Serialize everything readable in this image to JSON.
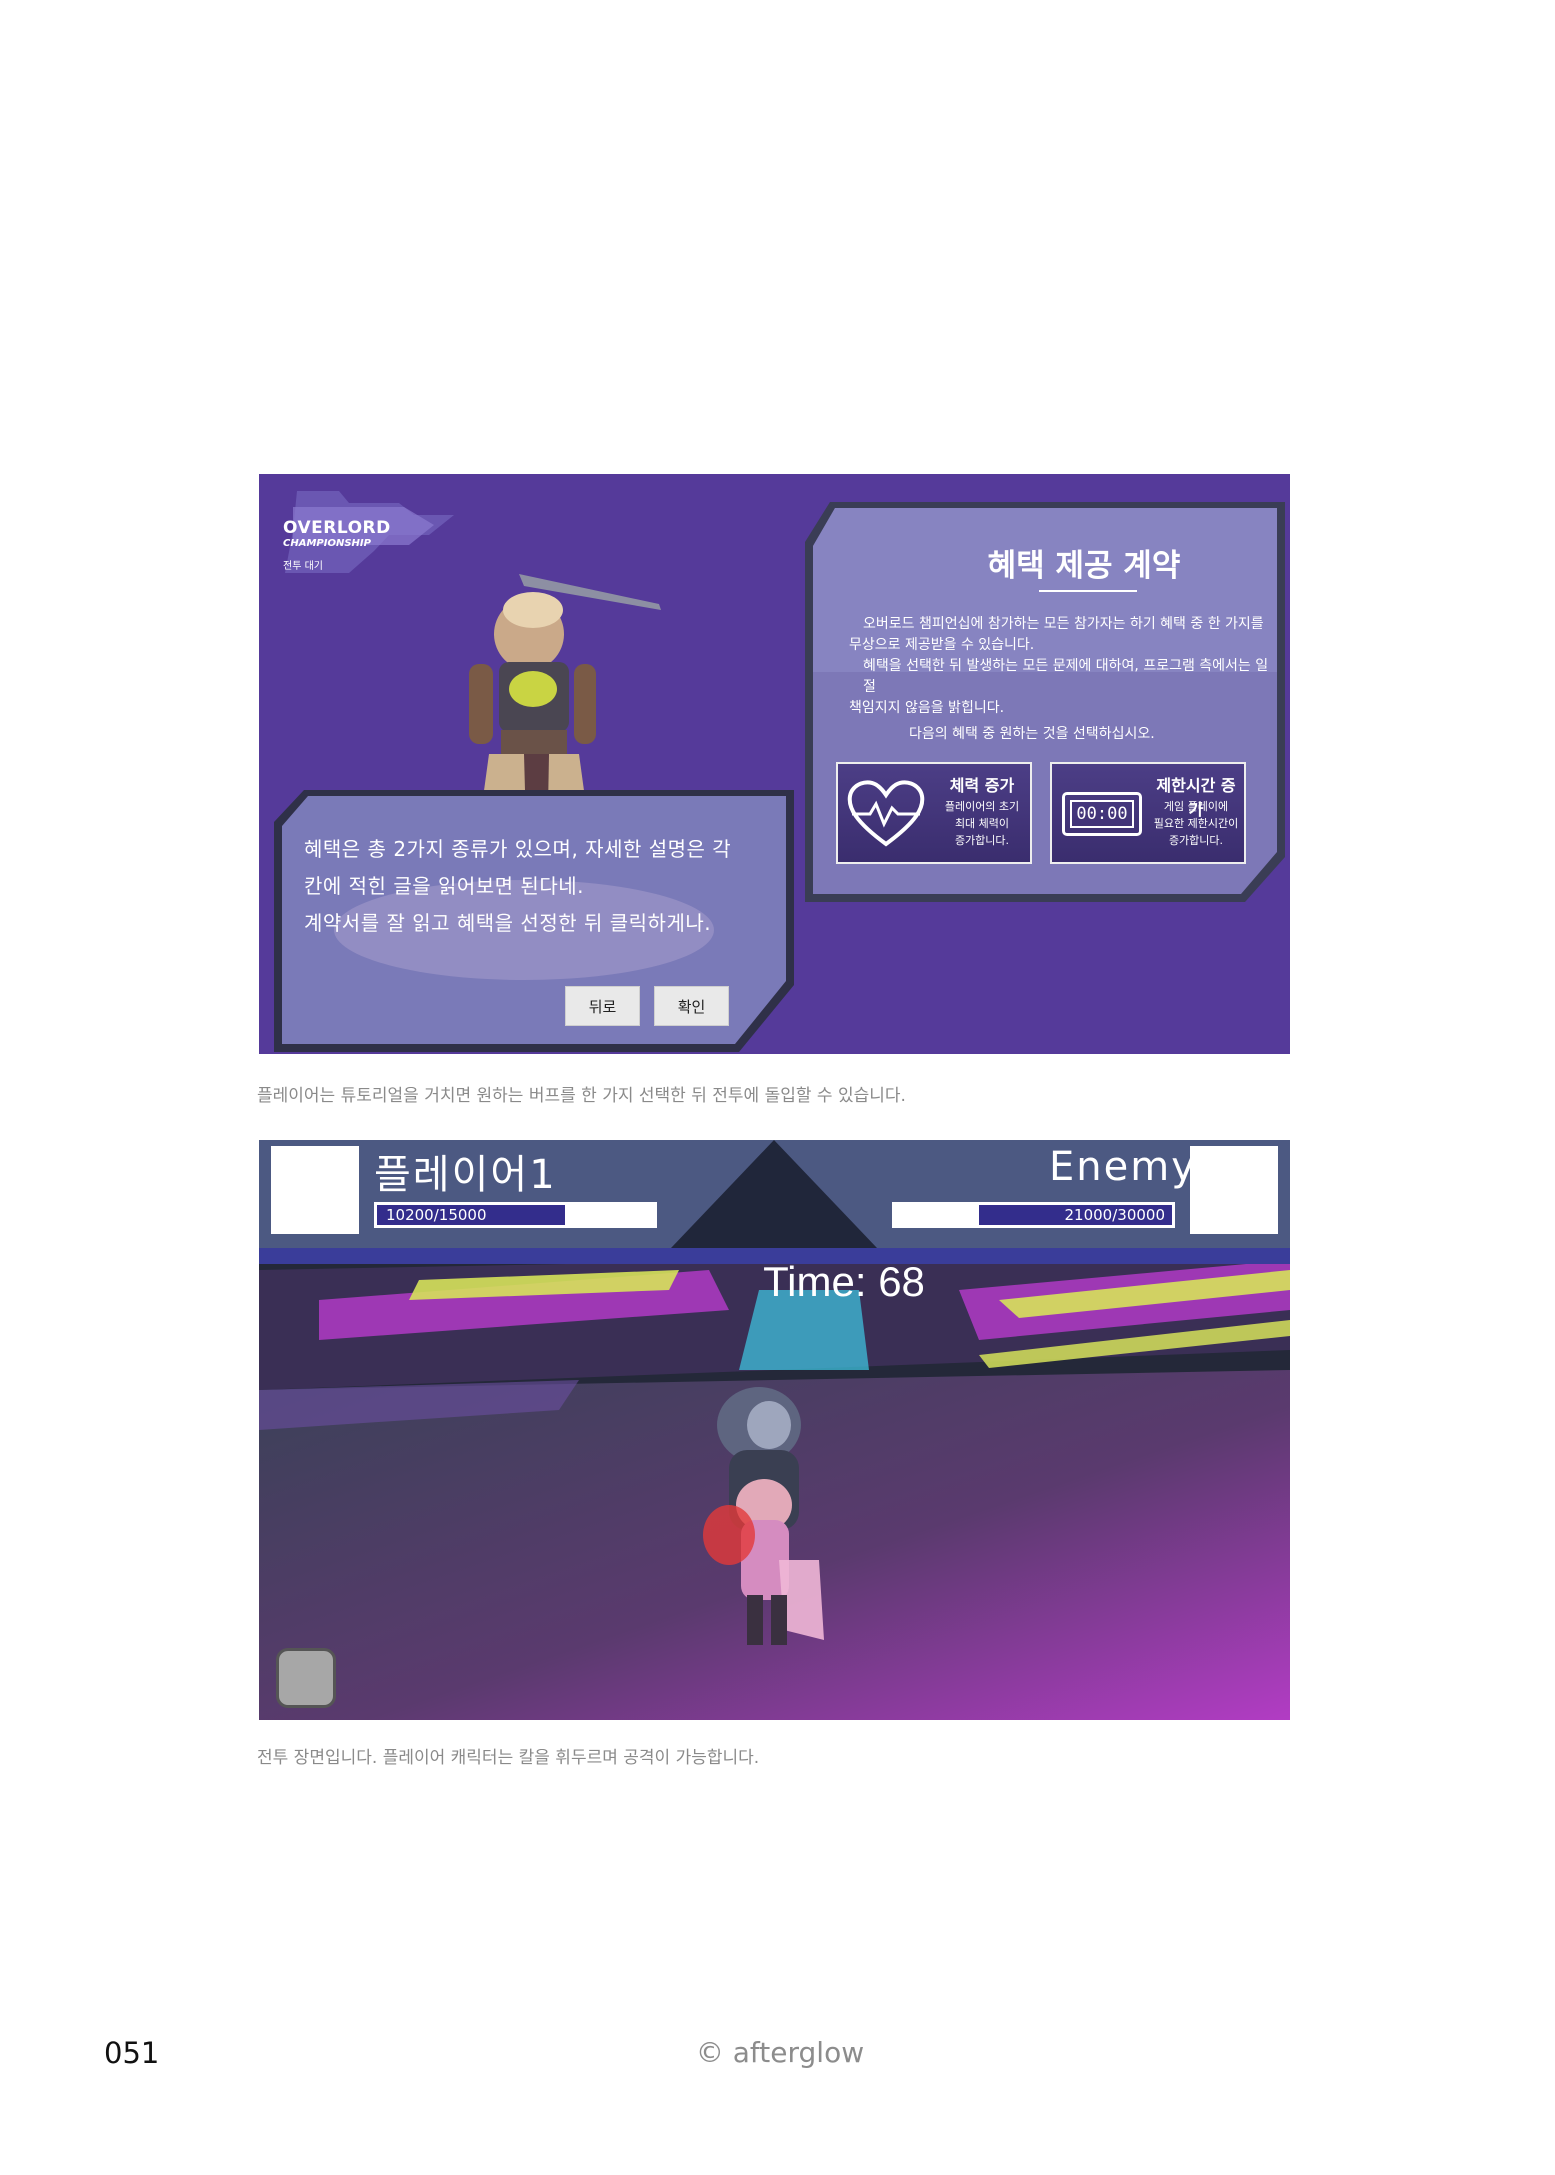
{
  "screen1": {
    "logo": {
      "title": "OVERLORD",
      "subtitle": "CHAMPIONSHIP",
      "state": "전투 대기"
    },
    "contract": {
      "title": "혜택 제공 계약",
      "body_lines": [
        "오버로드 챔피언십에 참가하는 모든 참가자는 하기 혜택 중 한 가지를",
        "무상으로 제공받을 수 있습니다.",
        "혜택을 선택한 뒤 발생하는 모든 문제에 대하여, 프로그램 측에서는 일절",
        "책임지지 않음을 밝힙니다."
      ],
      "prompt": "다음의 혜택 중 원하는 것을 선택하십시오.",
      "options": [
        {
          "title": "체력 증가",
          "desc_lines": [
            "플레이어의 초기",
            "최대 체력이",
            "증가합니다."
          ],
          "icon": "heart-pulse-icon"
        },
        {
          "title": "제한시간 증가",
          "desc_lines": [
            "게임 플레이에",
            "필요한 제한시간이",
            "증가합니다."
          ],
          "icon": "digital-clock-icon"
        }
      ],
      "clock_display": "00:00"
    },
    "dialog": {
      "lines": [
        "혜택은 총 2가지 종류가 있으며, 자세한 설명은 각",
        "칸에 적힌 글을 읽어보면 된다네.",
        "계약서를 잘 읽고 혜택을 선정한 뒤 클릭하게나."
      ],
      "back_label": "뒤로",
      "confirm_label": "확인"
    },
    "caption": "플레이어는 튜토리얼을 거치면 원하는 버프를 한 가지 선택한 뒤 전투에 돌입할 수 있습니다."
  },
  "screen2": {
    "player": {
      "name": "플레이어1",
      "hp_text": "10200/15000",
      "hp_fraction": 0.68
    },
    "enemy": {
      "name": "Enemy",
      "hp_text": "21000/30000",
      "hp_fraction": 0.7
    },
    "timer": "Time: 68",
    "caption": "전투 장면입니다. 플레이어 캐릭터는 칼을 휘두르며 공격이 가능합니다."
  },
  "footer": {
    "page_number": "051",
    "credit": "© afterglow"
  },
  "colors": {
    "panel_purple": "#553a9a",
    "hp_blue": "#332d8c",
    "neon_magenta": "#b63bd0",
    "neon_yellow": "#d6e25a",
    "neon_cyan": "#3fc9e6"
  }
}
